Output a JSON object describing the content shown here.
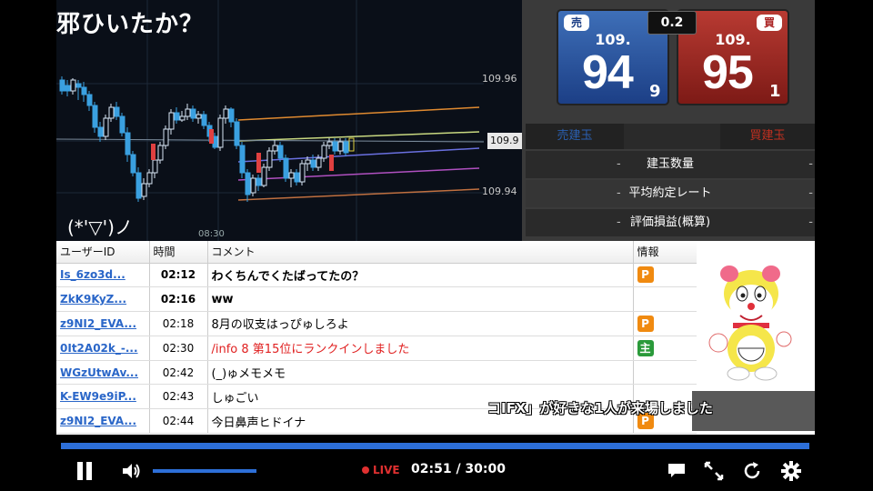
{
  "overlay": {
    "title": "邪ひいたか？",
    "emote": "(*'▽')ノ"
  },
  "chart": {
    "y_labels": [
      "109.96",
      "109.94"
    ],
    "price_tag": "109.9",
    "time_tick": "08:30"
  },
  "trade": {
    "sell": {
      "badge": "売",
      "prefix": "109.",
      "big": "94",
      "sub": "9"
    },
    "buy": {
      "badge": "買",
      "prefix": "109.",
      "big": "95",
      "sub": "1"
    },
    "spread": "0.2",
    "sell_order_label": "売建玉",
    "buy_order_label": "買建玉",
    "rows": [
      {
        "label": "建玉数量",
        "left": "-",
        "right": "-"
      },
      {
        "label": "平均約定レート",
        "left": "-",
        "right": "-"
      },
      {
        "label": "評価損益(概算)",
        "left": "-",
        "right": "-"
      }
    ]
  },
  "comments": {
    "headers": {
      "user": "ユーザーID",
      "time": "時間",
      "comment": "コメント",
      "info": "情報"
    },
    "rows": [
      {
        "user": "Is_6zo3d...",
        "time": "02:12",
        "msg": "わくちんでくたばってたの？",
        "badge": "P"
      },
      {
        "user": "ZkK9KyZ...",
        "time": "02:16",
        "msg": "ww",
        "badge": ""
      },
      {
        "user": "z9NI2_EVA...",
        "time": "02:18",
        "msg": "8月の収支はっぴゅしろよ",
        "badge": "P"
      },
      {
        "user": "0It2A02k_-...",
        "time": "02:30",
        "msg": "/info 8 第15位にランクインしました",
        "badge": "主"
      },
      {
        "user": "WGzUtwAv...",
        "time": "02:42",
        "msg": "(_)ゅメモメモ",
        "badge": ""
      },
      {
        "user": "K-EW9e9iP...",
        "time": "02:43",
        "msg": "しゅごい",
        "badge": ""
      },
      {
        "user": "z9NI2_EVA...",
        "time": "02:44",
        "msg": "今日鼻声ヒドイナ",
        "badge": "P"
      }
    ]
  },
  "ticker": "コIFX」が好きな1人が来場しました",
  "player": {
    "live_label": "LIVE",
    "time": "02:51 / 30:00",
    "progress": 1.0,
    "volume": 1.0
  },
  "colors": {
    "accent_blue": "#2d6fd8",
    "live_red": "#e03030",
    "sell_blue": "#1c3f86",
    "buy_red": "#a22020",
    "premium_orange": "#f08a10",
    "owner_green": "#2a9a3a"
  },
  "icons": [
    "pause-icon",
    "volume-icon",
    "comment-icon",
    "fullscreen-icon",
    "reload-icon",
    "settings-icon"
  ]
}
